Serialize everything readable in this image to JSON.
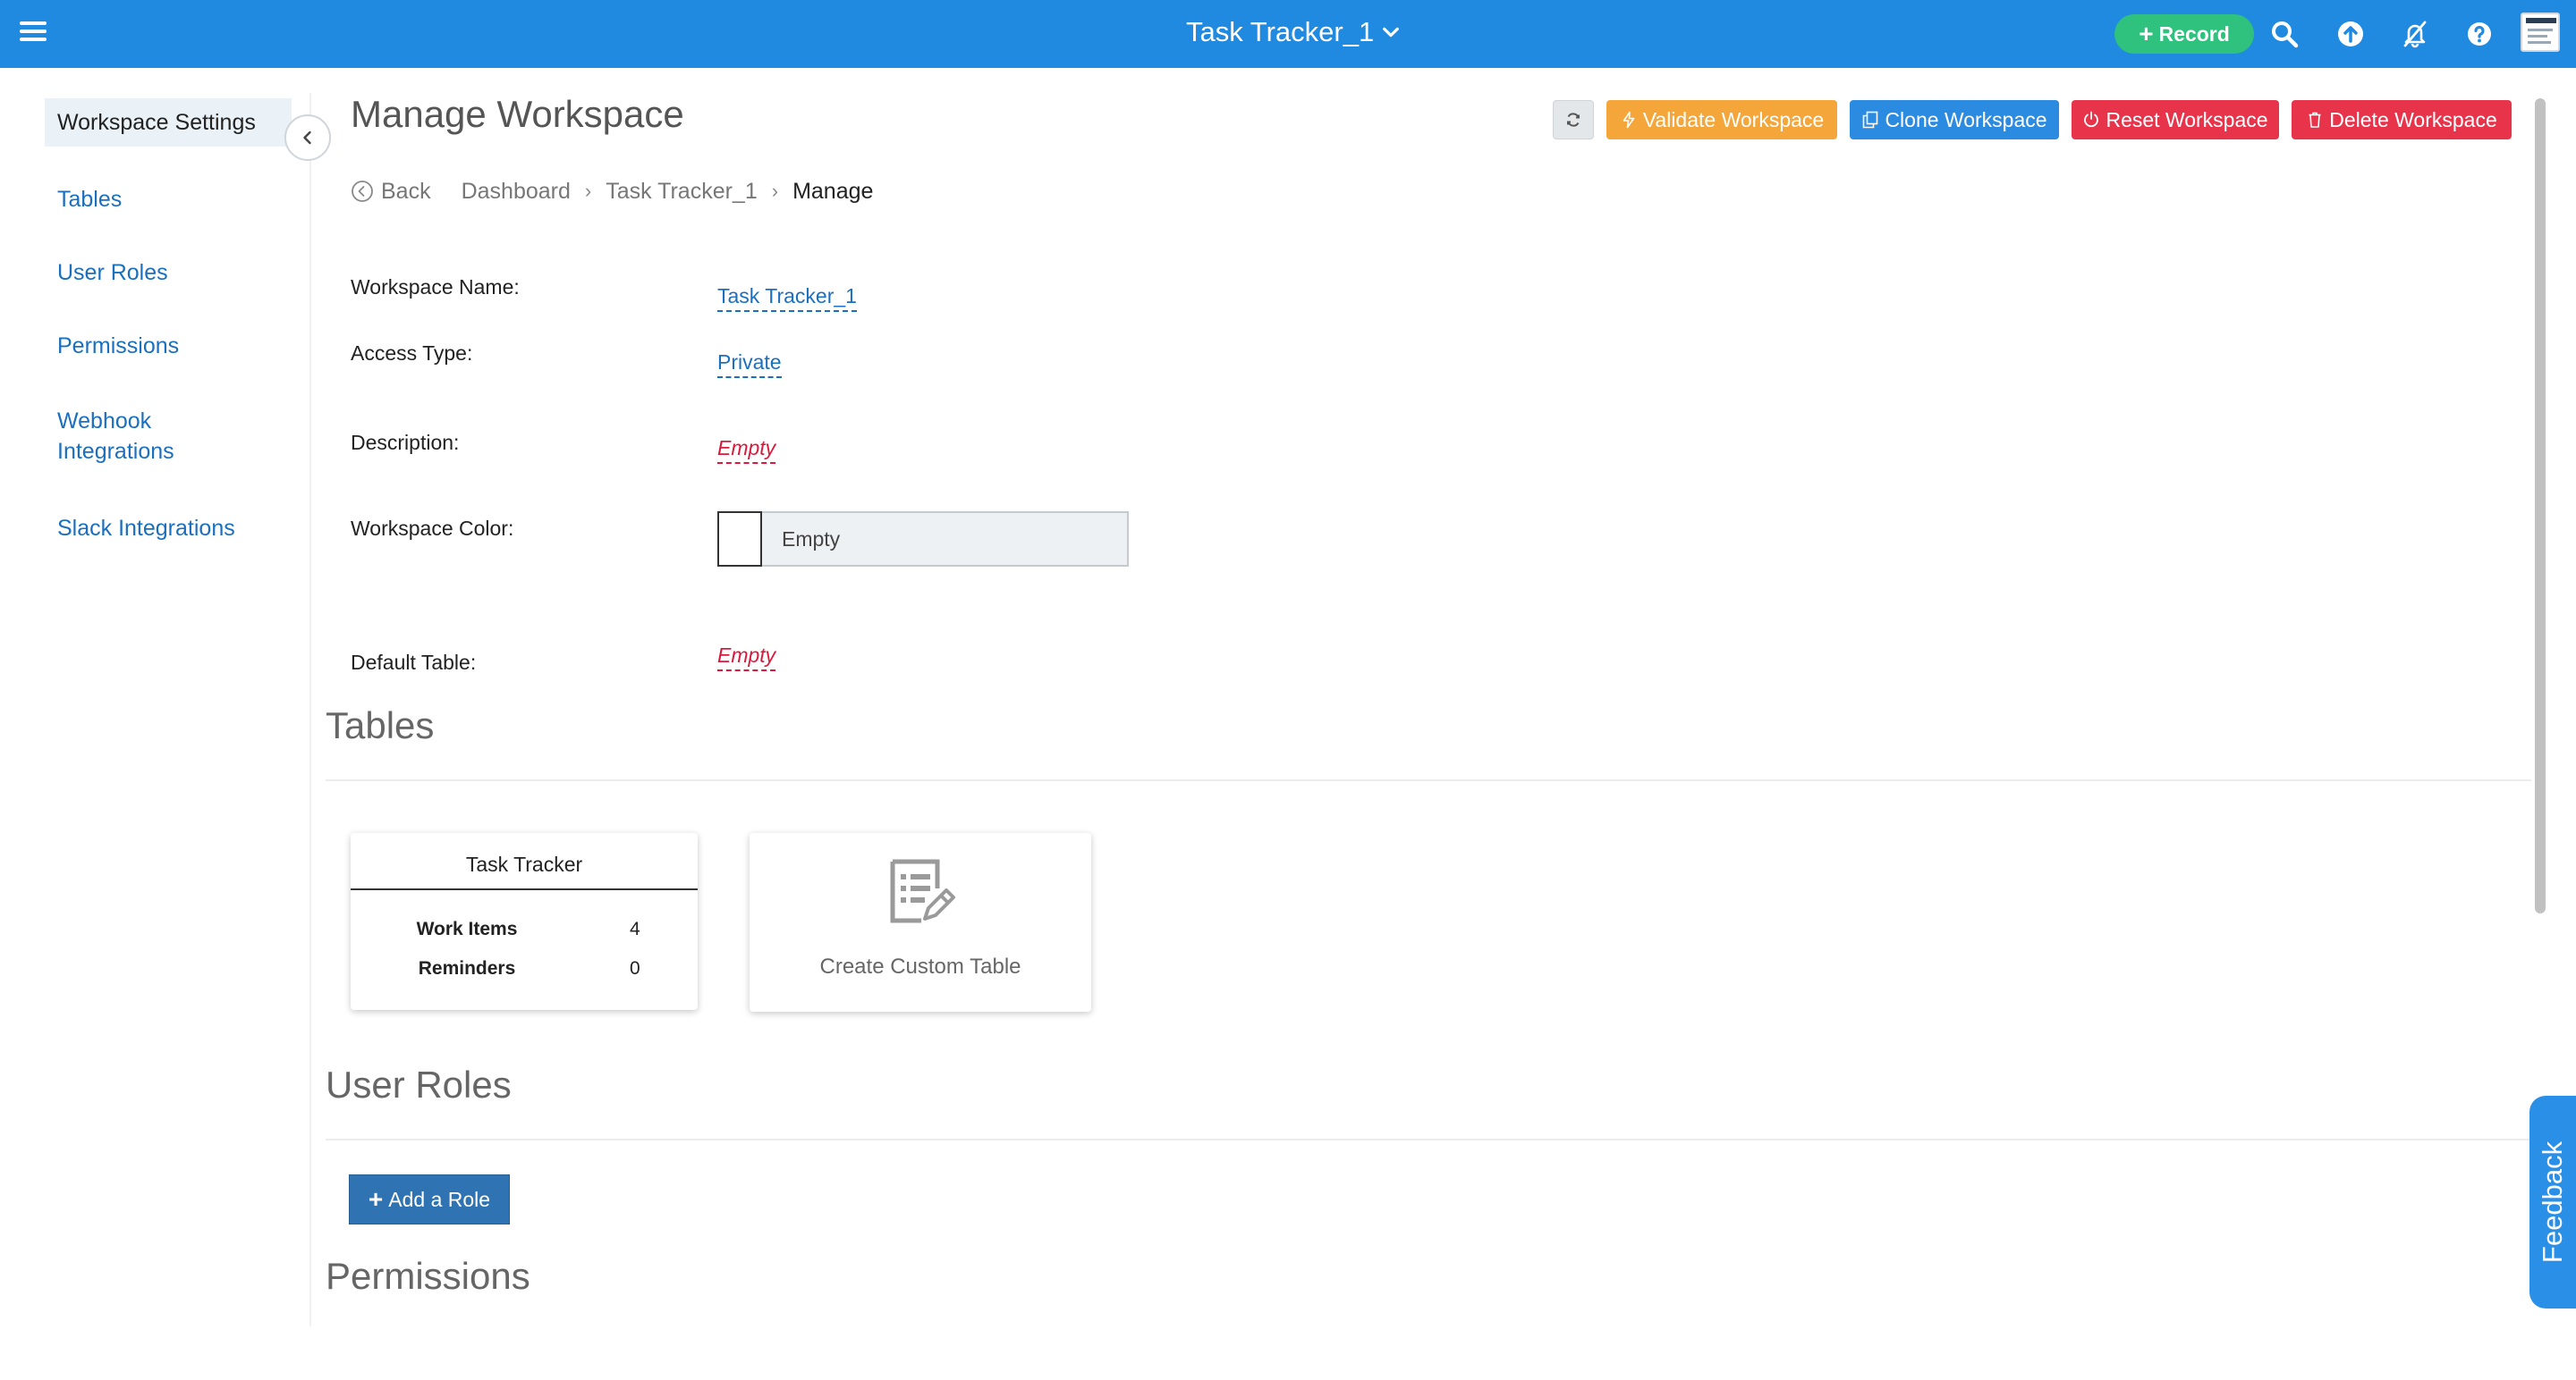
{
  "topbar": {
    "workspace_title": "Task Tracker_1",
    "record_label": "Record",
    "icons": [
      "menu-icon",
      "chevron-down-icon",
      "search-icon",
      "upload-icon",
      "notifications-off-icon",
      "help-icon"
    ]
  },
  "sidebar": {
    "items": [
      {
        "label": "Workspace Settings"
      },
      {
        "label": "Tables"
      },
      {
        "label": "User Roles"
      },
      {
        "label": "Permissions"
      },
      {
        "label": "Webhook Integrations"
      },
      {
        "label": "Slack Integrations"
      }
    ]
  },
  "page": {
    "title": "Manage Workspace",
    "actions": {
      "validate": "Validate Workspace",
      "clone": "Clone Workspace",
      "reset": "Reset Workspace",
      "delete": "Delete Workspace"
    },
    "breadcrumb": {
      "back": "Back",
      "dashboard": "Dashboard",
      "workspace": "Task Tracker_1",
      "current": "Manage"
    }
  },
  "fields": {
    "name": {
      "label": "Workspace Name:",
      "value": "Task Tracker_1"
    },
    "access": {
      "label": "Access Type:",
      "value": "Private"
    },
    "description": {
      "label": "Description:",
      "value": "Empty"
    },
    "color": {
      "label": "Workspace Color:",
      "value": "Empty"
    },
    "default_table": {
      "label": "Default Table:",
      "value": "Empty"
    }
  },
  "sections": {
    "tables": "Tables",
    "user_roles": "User Roles",
    "permissions": "Permissions"
  },
  "tables": {
    "card": {
      "title": "Task Tracker",
      "rows": [
        {
          "label": "Work Items",
          "value": "4"
        },
        {
          "label": "Reminders",
          "value": "0"
        }
      ]
    },
    "create_label": "Create Custom Table"
  },
  "roles": {
    "add_label": "Add a Role"
  },
  "feedback": {
    "label": "Feedback"
  },
  "colors": {
    "topbar": "#1f8ae0",
    "record": "#2ec27e",
    "validate": "#f5a63a",
    "clone": "#2b8be0",
    "reset": "#e8344b",
    "delete": "#e8344b",
    "link": "#1a6fbf",
    "empty": "#d81b3c",
    "add_role": "#2f73b3"
  }
}
